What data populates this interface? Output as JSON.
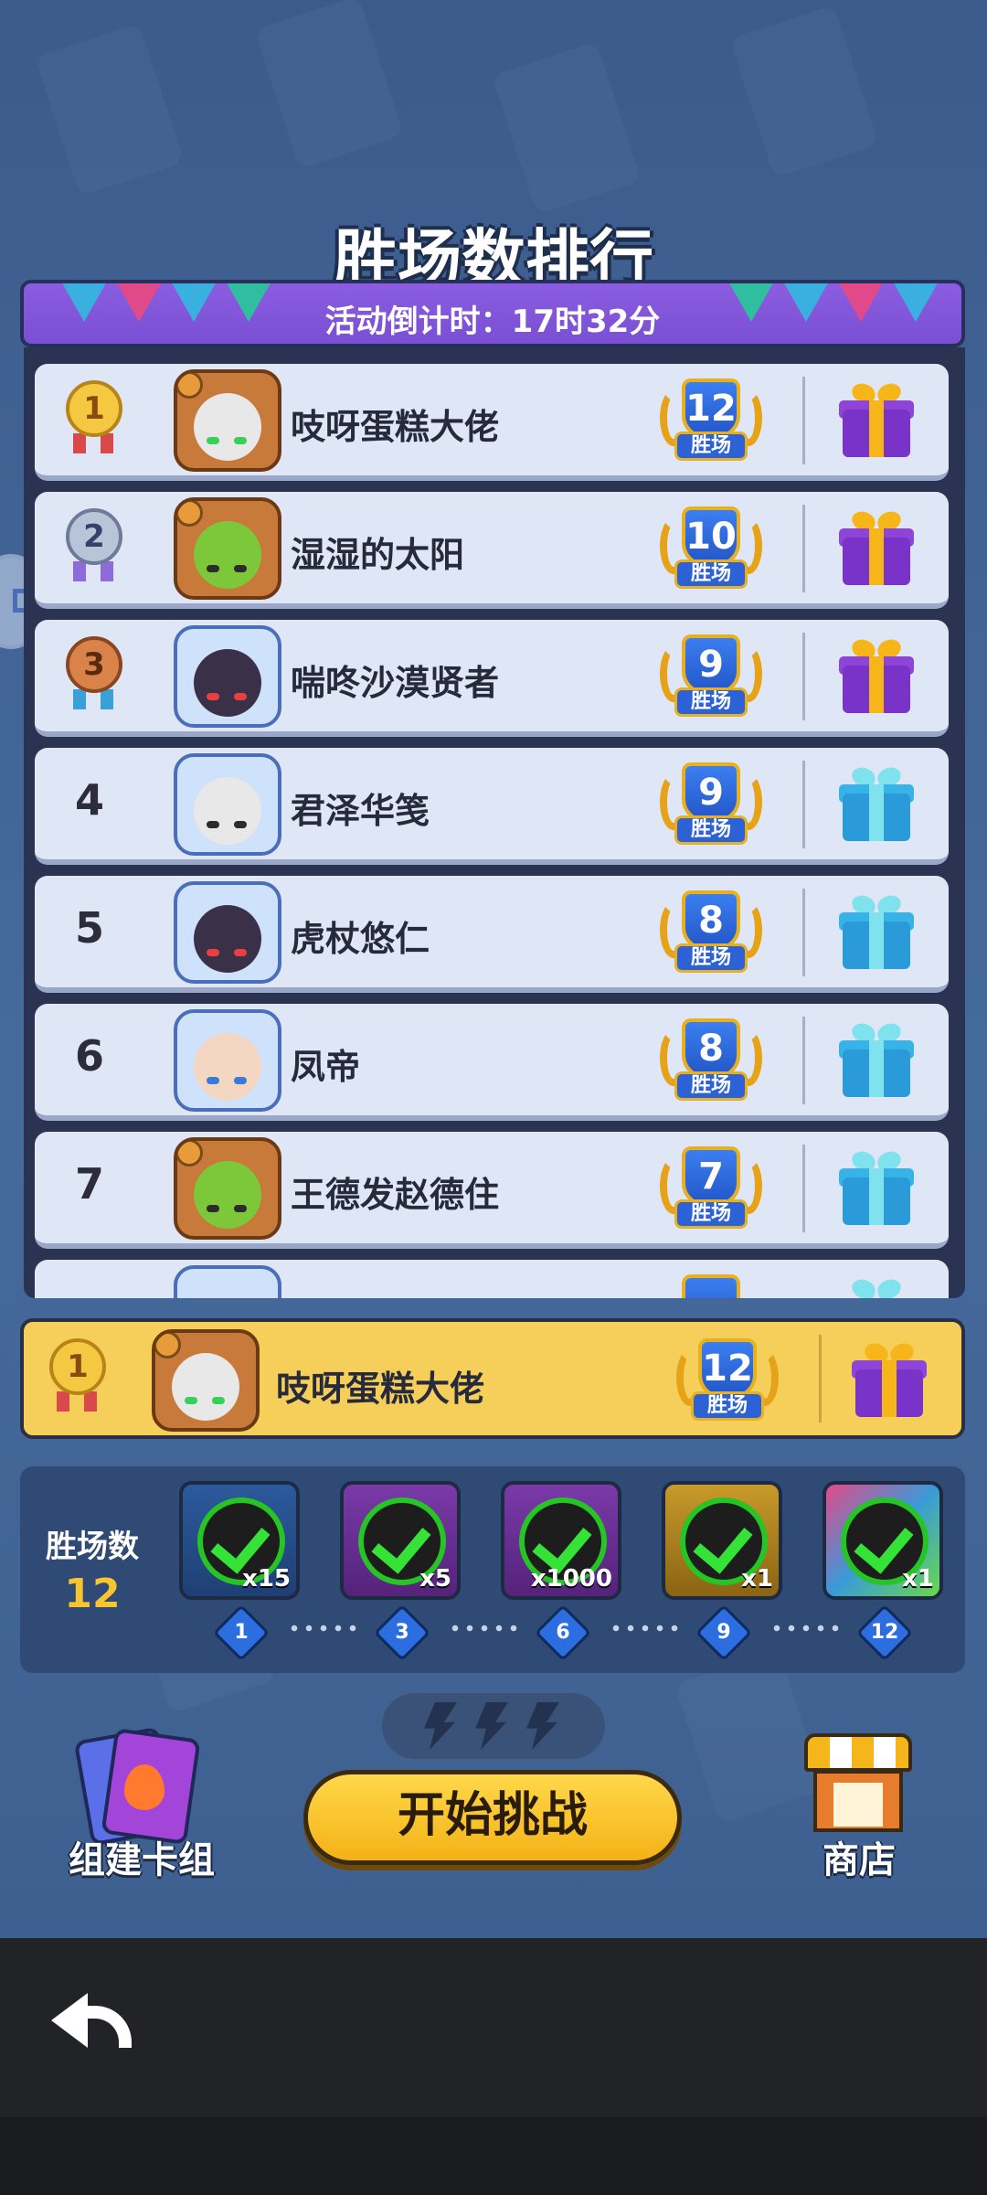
{
  "header": {
    "title": "胜场数排行",
    "countdown": "活动倒计时：17时32分"
  },
  "ranking": {
    "rows": [
      {
        "rank": "1",
        "name": "吱呀蛋糕大佬",
        "wins": "12",
        "wins_label": "胜场",
        "gift": "purple"
      },
      {
        "rank": "2",
        "name": "湿湿的太阳",
        "wins": "10",
        "wins_label": "胜场",
        "gift": "purple"
      },
      {
        "rank": "3",
        "name": "喘咚沙漠贤者",
        "wins": "9",
        "wins_label": "胜场",
        "gift": "purple"
      },
      {
        "rank": "4",
        "name": "君泽华笺",
        "wins": "9",
        "wins_label": "胜场",
        "gift": "blue"
      },
      {
        "rank": "5",
        "name": "虎杖悠仁",
        "wins": "8",
        "wins_label": "胜场",
        "gift": "blue"
      },
      {
        "rank": "6",
        "name": "凤帝",
        "wins": "8",
        "wins_label": "胜场",
        "gift": "blue"
      },
      {
        "rank": "7",
        "name": "王德发赵德住",
        "wins": "7",
        "wins_label": "胜场",
        "gift": "blue"
      }
    ]
  },
  "self": {
    "rank": "1",
    "name": "吱呀蛋糕大佬",
    "wins": "12",
    "wins_label": "胜场"
  },
  "progress": {
    "label": "胜场数",
    "count": "12",
    "rewards": [
      {
        "qty": "x15",
        "tier": "1"
      },
      {
        "qty": "x5",
        "tier": "3"
      },
      {
        "qty": "x1000",
        "tier": "6"
      },
      {
        "qty": "x1",
        "tier": "9"
      },
      {
        "qty": "x1",
        "tier": "12"
      }
    ]
  },
  "actions": {
    "deck": "组建卡组",
    "start": "开始挑战",
    "shop": "商店"
  },
  "colors": {
    "medal_gold": "#f5c842",
    "medal_silver": "#b8c4d8",
    "medal_bronze": "#d9824a",
    "accent": "#f6cf5a"
  }
}
